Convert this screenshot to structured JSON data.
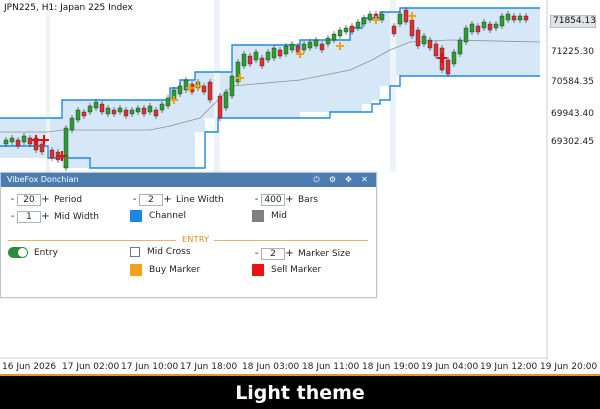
{
  "chart": {
    "title": "JPN225, H1:  Japan 225 Index",
    "price_levels": [
      "71854.13",
      "71225.30",
      "70584.35",
      "69943.40",
      "69302.45"
    ],
    "time_labels": [
      "16 Jun 2026",
      "17 Jun 02:00",
      "17 Jun 10:00",
      "17 Jun 18:00",
      "18 Jun 03:00",
      "18 Jun 11:00",
      "18 Jun 19:00",
      "19 Jun 04:00",
      "19 Jun 12:00",
      "19 Jun 20:00"
    ],
    "colors": {
      "bull": "#2ca02c",
      "bear": "#e03030",
      "channel": "#1e88e5",
      "fill": "#d6e8f8",
      "mid": "#909090",
      "buy": "#f0a020",
      "sell": "#e01010"
    }
  },
  "panel": {
    "title": "VibeFox Donchian",
    "header_icons": [
      "power-icon",
      "gear-icon",
      "move-icon",
      "close-icon"
    ],
    "period": {
      "value": "20",
      "label": "Period"
    },
    "line_width": {
      "value": "2",
      "label": "Line Width"
    },
    "bars": {
      "value": "400",
      "label": "Bars"
    },
    "mid_width": {
      "value": "1",
      "label": "Mid Width"
    },
    "channel": {
      "label": "Channel",
      "color": "#1e88e5"
    },
    "mid": {
      "label": "Mid",
      "color": "#808080"
    },
    "section_entry": "ENTRY",
    "entry": {
      "label": "Entry",
      "enabled": true
    },
    "mid_cross": {
      "label": "Mid Cross",
      "checked": false
    },
    "marker_size": {
      "value": "2",
      "label": "Marker Size"
    },
    "buy_marker": {
      "label": "Buy Marker",
      "color": "#f5a21b"
    },
    "sell_marker": {
      "label": "Sell Marker",
      "color": "#f01010"
    }
  },
  "footer": {
    "text": "Light theme"
  }
}
